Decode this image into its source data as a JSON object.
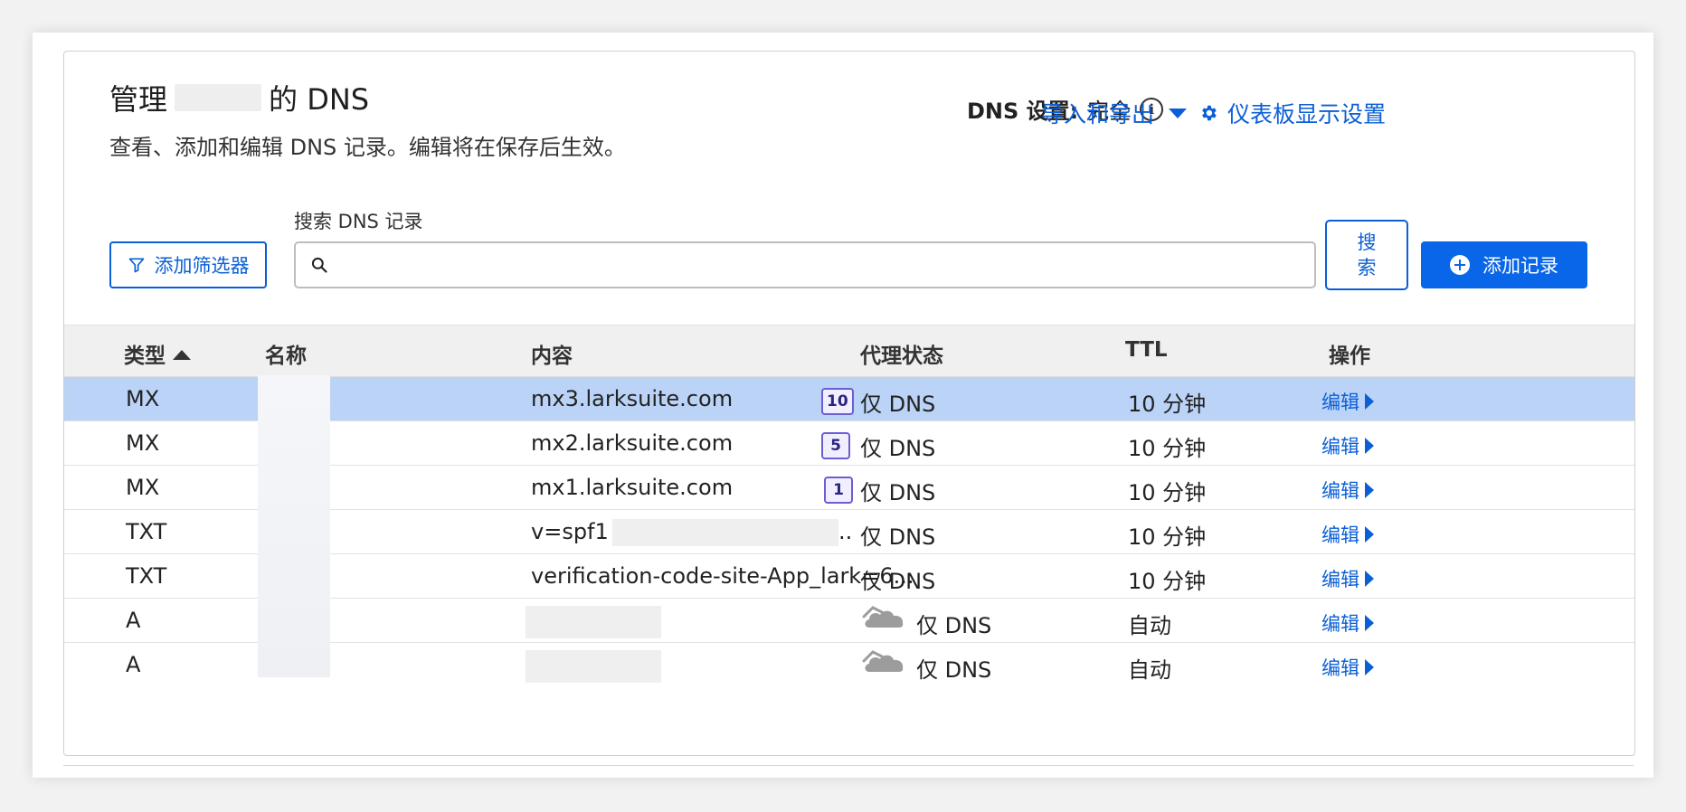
{
  "header": {
    "title_prefix": "管理",
    "title_suffix": "的 DNS",
    "subtitle": "查看、添加和编辑 DNS 记录。编辑将在保存后生效。",
    "dns_setting_label": "DNS 设置:",
    "dns_setting_value": "完全",
    "import_export_label": "导入和导出",
    "dashboard_settings_label": "仪表板显示设置"
  },
  "toolbar": {
    "filter_button_label": "添加筛选器",
    "search_label": "搜索 DNS 记录",
    "search_placeholder": "",
    "search_button_label": "搜索",
    "add_record_label": "添加记录"
  },
  "table": {
    "columns": {
      "type": "类型",
      "name": "名称",
      "content": "内容",
      "proxy": "代理状态",
      "ttl": "TTL",
      "actions": "操作"
    },
    "rows": [
      {
        "type": "MX",
        "content": "mx3.larksuite.com",
        "priority": "10",
        "proxy": "仅 DNS",
        "ttl": "10 分钟",
        "edit": "编辑",
        "selected": true
      },
      {
        "type": "MX",
        "content": "mx2.larksuite.com",
        "priority": "5",
        "proxy": "仅 DNS",
        "ttl": "10 分钟",
        "edit": "编辑"
      },
      {
        "type": "MX",
        "content": "mx1.larksuite.com",
        "priority": "1",
        "proxy": "仅 DNS",
        "ttl": "10 分钟",
        "edit": "编辑"
      },
      {
        "type": "TXT",
        "content": "v=spf1 +i",
        "proxy": "仅 DNS",
        "ttl": "10 分钟",
        "edit": "编辑"
      },
      {
        "type": "TXT",
        "content": "verification-code-site-App_lark=6...",
        "proxy": "仅 DNS",
        "ttl": "10 分钟",
        "edit": "编辑"
      },
      {
        "type": "A",
        "content": "",
        "proxy": "仅 DNS",
        "ttl": "自动",
        "edit": "编辑",
        "cloud": true
      },
      {
        "type": "A",
        "content": "",
        "proxy": "仅 DNS",
        "ttl": "自动",
        "edit": "编辑",
        "cloud": true
      }
    ]
  },
  "colors": {
    "accent": "#0a5fd6",
    "selected_row": "#bad3f7",
    "primary_button": "#0a66e8"
  }
}
